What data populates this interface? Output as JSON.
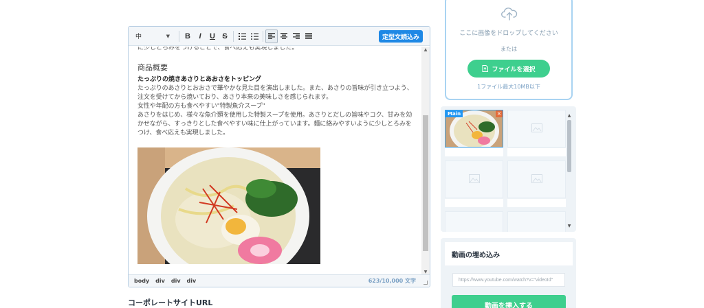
{
  "editor": {
    "toolbar": {
      "font_size": "中",
      "bold": "B",
      "italic": "I",
      "underline": "U",
      "strike": "S",
      "template_button": "定型文読込み"
    },
    "content": {
      "cut_line": "に少しとろみをつけることで、食べ応えも実現しました。",
      "section_title": "商品概要",
      "bold_line": "たっぷりの焼きあさりとあおさをトッピング",
      "paragraph1": "たっぷりのあさりとおおさで華やかな見た目を演出しました。また、あさりの旨味が引き立つよう、注文を受けてから焼いており、あさり本来の美味しさを感じられます。",
      "paragraph2": "女性や年配の方も食べやすい\"特製魚介スープ\"",
      "paragraph3": "あさりをはじめ、様々な魚介類を使用した特製スープを使用。あさりとだしの旨味やコク、甘みを効かせながら、すっきりとした食べやすい味に仕上がっています。麺に絡みやすいように少しとろみをつけ、食べ応えも実現しました。"
    },
    "status": {
      "path": [
        "body",
        "div",
        "div",
        "div"
      ],
      "counter": "623/10,000 文字"
    }
  },
  "corporate_site_label": "コーポレートサイトURL",
  "upload": {
    "drop_text": "ここに画像をドロップしてください",
    "or_text": "または",
    "select_button": "ファイルを選択",
    "limit_text": "1ファイル最大10MB以下"
  },
  "thumbnails": {
    "main_badge": "Main",
    "delete": "×"
  },
  "video": {
    "title": "動画の埋め込み",
    "url_placeholder": "https://www.youtube.com/watch?v=\"videoId\"",
    "insert_button": "動画を挿入する"
  },
  "colors": {
    "accent_blue": "#1e88e5",
    "green": "#3ecf8e",
    "upload_border": "#a9d3f2"
  }
}
